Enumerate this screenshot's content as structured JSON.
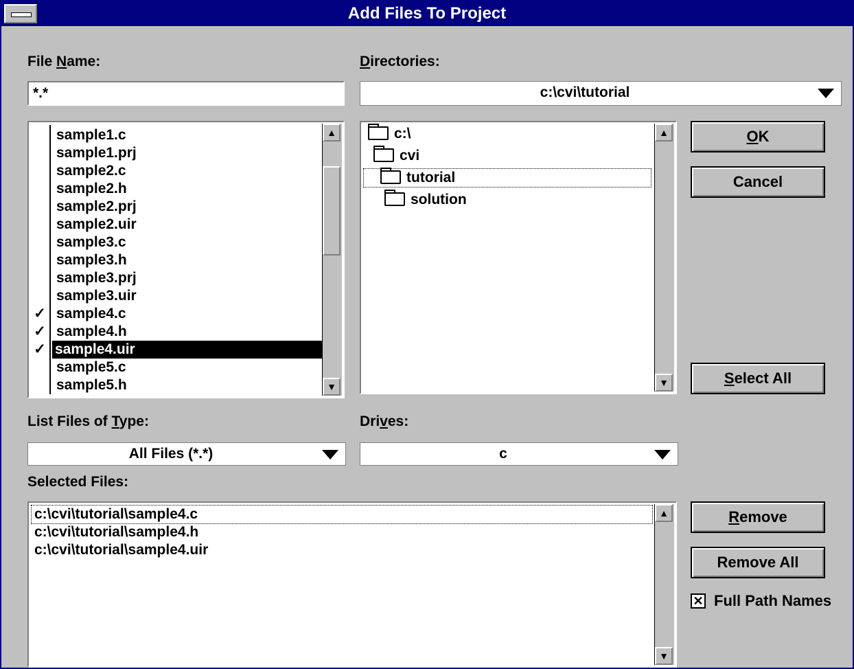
{
  "window": {
    "title": "Add Files To Project"
  },
  "file_name": {
    "label_pre": "File ",
    "label_key": "N",
    "label_post": "ame:",
    "value": "*.*"
  },
  "directories": {
    "label_key": "D",
    "label_post": "irectories:",
    "current": "c:\\cvi\\tutorial",
    "tree": [
      "c:\\",
      "cvi",
      "tutorial",
      "solution"
    ]
  },
  "files": [
    {
      "name": "sample1.c",
      "checked": false
    },
    {
      "name": "sample1.prj",
      "checked": false
    },
    {
      "name": "sample2.c",
      "checked": false
    },
    {
      "name": "sample2.h",
      "checked": false
    },
    {
      "name": "sample2.prj",
      "checked": false
    },
    {
      "name": "sample2.uir",
      "checked": false
    },
    {
      "name": "sample3.c",
      "checked": false
    },
    {
      "name": "sample3.h",
      "checked": false
    },
    {
      "name": "sample3.prj",
      "checked": false
    },
    {
      "name": "sample3.uir",
      "checked": false
    },
    {
      "name": "sample4.c",
      "checked": true
    },
    {
      "name": "sample4.h",
      "checked": true
    },
    {
      "name": "sample4.uir",
      "checked": true
    },
    {
      "name": "sample5.c",
      "checked": false
    },
    {
      "name": "sample5.h",
      "checked": false
    }
  ],
  "file_type": {
    "label_pre": "List Files of ",
    "label_key": "T",
    "label_post": "ype:",
    "value": "All Files (*.*)"
  },
  "drives": {
    "label_pre": "Dri",
    "label_key": "v",
    "label_post": "es:",
    "value": "c"
  },
  "selected_files": {
    "label": "Selected Files:",
    "items": [
      "c:\\cvi\\tutorial\\sample4.c",
      "c:\\cvi\\tutorial\\sample4.h",
      "c:\\cvi\\tutorial\\sample4.uir"
    ]
  },
  "buttons": {
    "ok_key": "O",
    "ok_post": "K",
    "cancel": "Cancel",
    "select_all_key": "S",
    "select_all_post": "elect All",
    "remove_key": "R",
    "remove_post": "emove",
    "remove_all": "Remove All"
  },
  "full_path": {
    "label": "Full Path Names",
    "checked": true,
    "mark": "✕"
  },
  "glyphs": {
    "up": "▲",
    "down": "▼",
    "check": "✓"
  }
}
